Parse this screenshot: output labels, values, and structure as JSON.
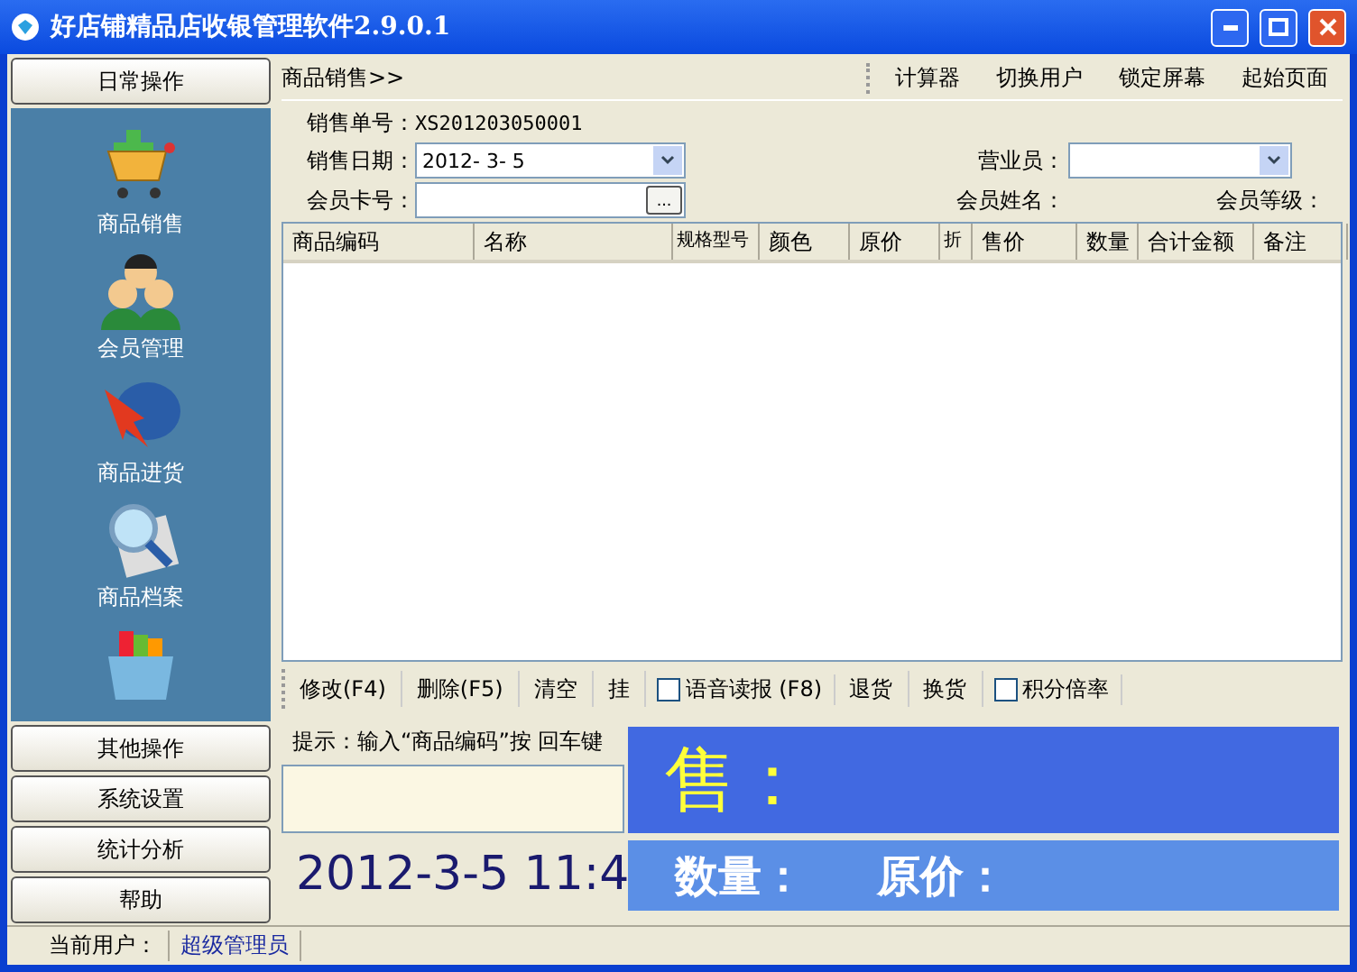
{
  "window": {
    "title": "好店铺精品店收银管理软件2.9.0.1"
  },
  "sidebar": {
    "top_button": "日常操作",
    "items": [
      {
        "label": "商品销售",
        "kind": "cart"
      },
      {
        "label": "会员管理",
        "kind": "people"
      },
      {
        "label": "商品进货",
        "kind": "truck"
      },
      {
        "label": "商品档案",
        "kind": "magnifier"
      },
      {
        "kind": "box"
      }
    ],
    "bottom_buttons": [
      "其他操作",
      "系统设置",
      "统计分析",
      "帮助"
    ]
  },
  "breadcrumb": "商品销售>>",
  "toolbar": [
    "计算器",
    "切换用户",
    "锁定屏幕",
    "起始页面"
  ],
  "form": {
    "order_label": "销售单号：",
    "order_value": "XS201203050001",
    "date_label": "销售日期：",
    "date_value": "2012- 3- 5",
    "clerk_label": "营业员：",
    "card_label": "会员卡号：",
    "card_button": "...",
    "name_label": "会员姓名：",
    "level_label": "会员等级："
  },
  "table": {
    "columns": [
      "商品编码",
      "名称",
      "规格型号",
      "颜色",
      "原价",
      "折",
      "售价",
      "数量",
      "合计金额",
      "备注"
    ]
  },
  "actions": [
    {
      "kind": "button",
      "label": "修改(F4)"
    },
    {
      "kind": "button",
      "label": "删除(F5)"
    },
    {
      "kind": "button",
      "label": "清空"
    },
    {
      "kind": "button",
      "label": "挂"
    },
    {
      "kind": "checkbox",
      "label": "语音读报 (F8)",
      "checked": false
    },
    {
      "kind": "button",
      "label": "退货"
    },
    {
      "kind": "button",
      "label": "换货"
    },
    {
      "kind": "checkbox",
      "label": "积分倍率",
      "checked": false
    }
  ],
  "hint": "提示：输入“商品编码”按 回车键",
  "clock": "2012-3-5 11:4",
  "display": {
    "sale_label": "售：",
    "qty_label": "数量：",
    "price_label": "原价："
  },
  "status_bar": {
    "label": "当前用户：",
    "user": "超级管理员"
  }
}
